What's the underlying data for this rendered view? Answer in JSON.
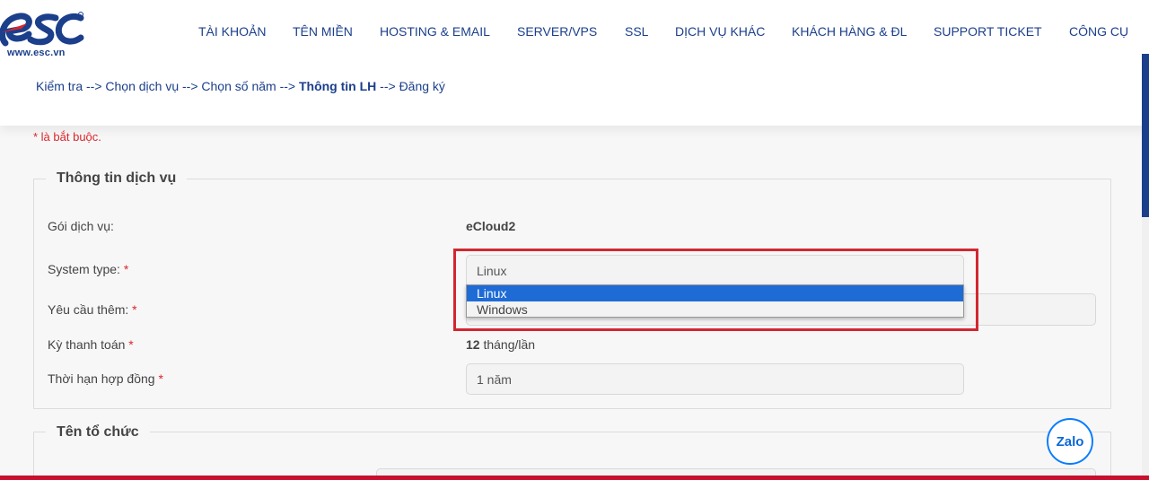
{
  "logo": {
    "url": "www.esc.vn"
  },
  "nav": {
    "items": [
      "TÀI KHOẢN",
      "TÊN MIỀN",
      "HOSTING & EMAIL",
      "SERVER/VPS",
      "SSL",
      "DỊCH VỤ KHÁC",
      "KHÁCH HÀNG & ĐL",
      "SUPPORT TICKET",
      "CÔNG CỤ"
    ]
  },
  "breadcrumb": {
    "steps": [
      "Kiểm tra",
      "Chọn dịch vụ",
      "Chọn số năm",
      "Thông tin LH",
      "Đăng ký"
    ],
    "separator": "-->",
    "active_step": "Thông tin LH"
  },
  "required_note": "* là bắt buộc.",
  "service_section": {
    "title": "Thông tin dịch vụ",
    "package_label": "Gói dịch vụ:",
    "package_value": "eCloud2",
    "system_type_label": "System type:",
    "system_type_value": "Linux",
    "system_type_options": [
      "Linux",
      "Windows"
    ],
    "extra_request_label": "Yêu cầu thêm:",
    "billing_label": "Kỳ thanh toán",
    "billing_value_number": "12",
    "billing_value_unit": "tháng/lần",
    "contract_label": "Thời hạn hợp đồng",
    "contract_value": "1 năm",
    "required_star": "*"
  },
  "org_section": {
    "title": "Tên tổ chức"
  },
  "zalo": {
    "label": "Zalo"
  },
  "colors": {
    "brand_blue": "#1b3f8b",
    "required_red": "#d9262c",
    "highlight_red": "#d22730",
    "selected_blue": "#1e6bd6"
  }
}
